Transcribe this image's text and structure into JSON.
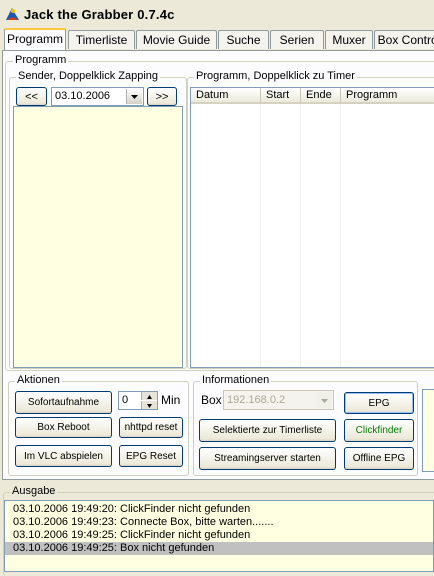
{
  "window": {
    "title": "Jack the Grabber 0.7.4c"
  },
  "tabs": [
    {
      "label": "Programm"
    },
    {
      "label": "Timerliste"
    },
    {
      "label": "Movie Guide"
    },
    {
      "label": "Suche"
    },
    {
      "label": "Serien"
    },
    {
      "label": "Muxer"
    },
    {
      "label": "Box Control"
    }
  ],
  "programm_group": {
    "label": "Programm"
  },
  "sender": {
    "label": "Sender, Doppelklick Zapping",
    "prev_label": "<<",
    "next_label": ">>",
    "date_value": "03.10.2006"
  },
  "programm_list": {
    "label": "Programm, Doppelklick zu Timer",
    "columns": [
      "Datum",
      "Start",
      "Ende",
      "Programm"
    ]
  },
  "aktionen": {
    "label": "Aktionen",
    "sofortaufnahme": "Sofortaufnahme",
    "min_value": "0",
    "min_label": "Min",
    "box_reboot": "Box Reboot",
    "nhttpd_reset": "nhttpd reset",
    "vlc": "Im VLC abspielen",
    "epg_reset": "EPG Reset"
  },
  "informationen": {
    "label": "Informationen",
    "box_label": "Box",
    "box_value": "192.168.0.2",
    "epg": "EPG",
    "timerliste": "Selektierte zur Timerliste",
    "clickfinder": "Clickfinder",
    "streaming": "Streamingserver starten",
    "offline_epg": "Offline EPG"
  },
  "ausgabe": {
    "label": "Ausgabe",
    "lines": [
      "03.10.2006 19:49:20: ClickFinder nicht gefunden",
      "03.10.2006 19:49:23: Connecte Box, bitte warten.......",
      "03.10.2006 19:49:25: ClickFinder nicht gefunden",
      "03.10.2006 19:49:25: Box nicht gefunden"
    ]
  }
}
